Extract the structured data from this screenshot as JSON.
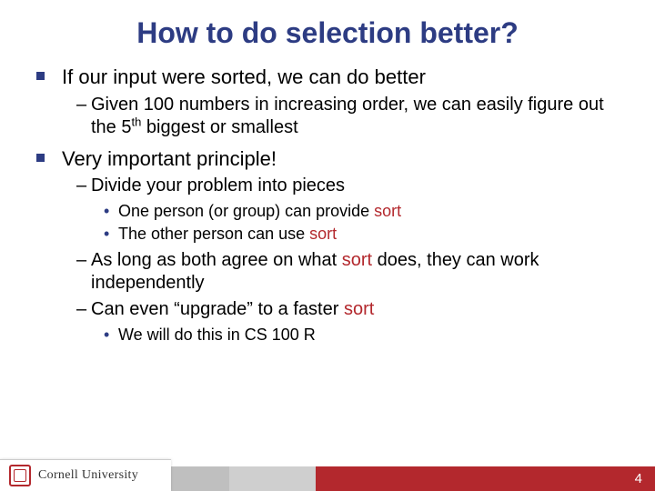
{
  "title": "How to do selection better?",
  "b1": {
    "p1": "If our input were sorted, we can do better",
    "s1a": "Given 100 numbers in increasing order, we can easily figure out the 5",
    "s1sup": "th",
    "s1b": " biggest or smallest",
    "p2": "Very important principle!",
    "s2": "Divide your problem into pieces",
    "s2i1a": "One person (or group) can provide ",
    "s2i1kw": "sort",
    "s2i2a": "The other person can use ",
    "s2i2kw": "sort",
    "s3a": "As long as both agree on what ",
    "s3kw": "sort",
    "s3b": " does, they can work independently",
    "s4a": "Can even “upgrade” to a faster ",
    "s4kw": "sort",
    "s4i1": "We will do this in CS 100 R"
  },
  "footer": {
    "univ": "Cornell University",
    "page": "4"
  }
}
